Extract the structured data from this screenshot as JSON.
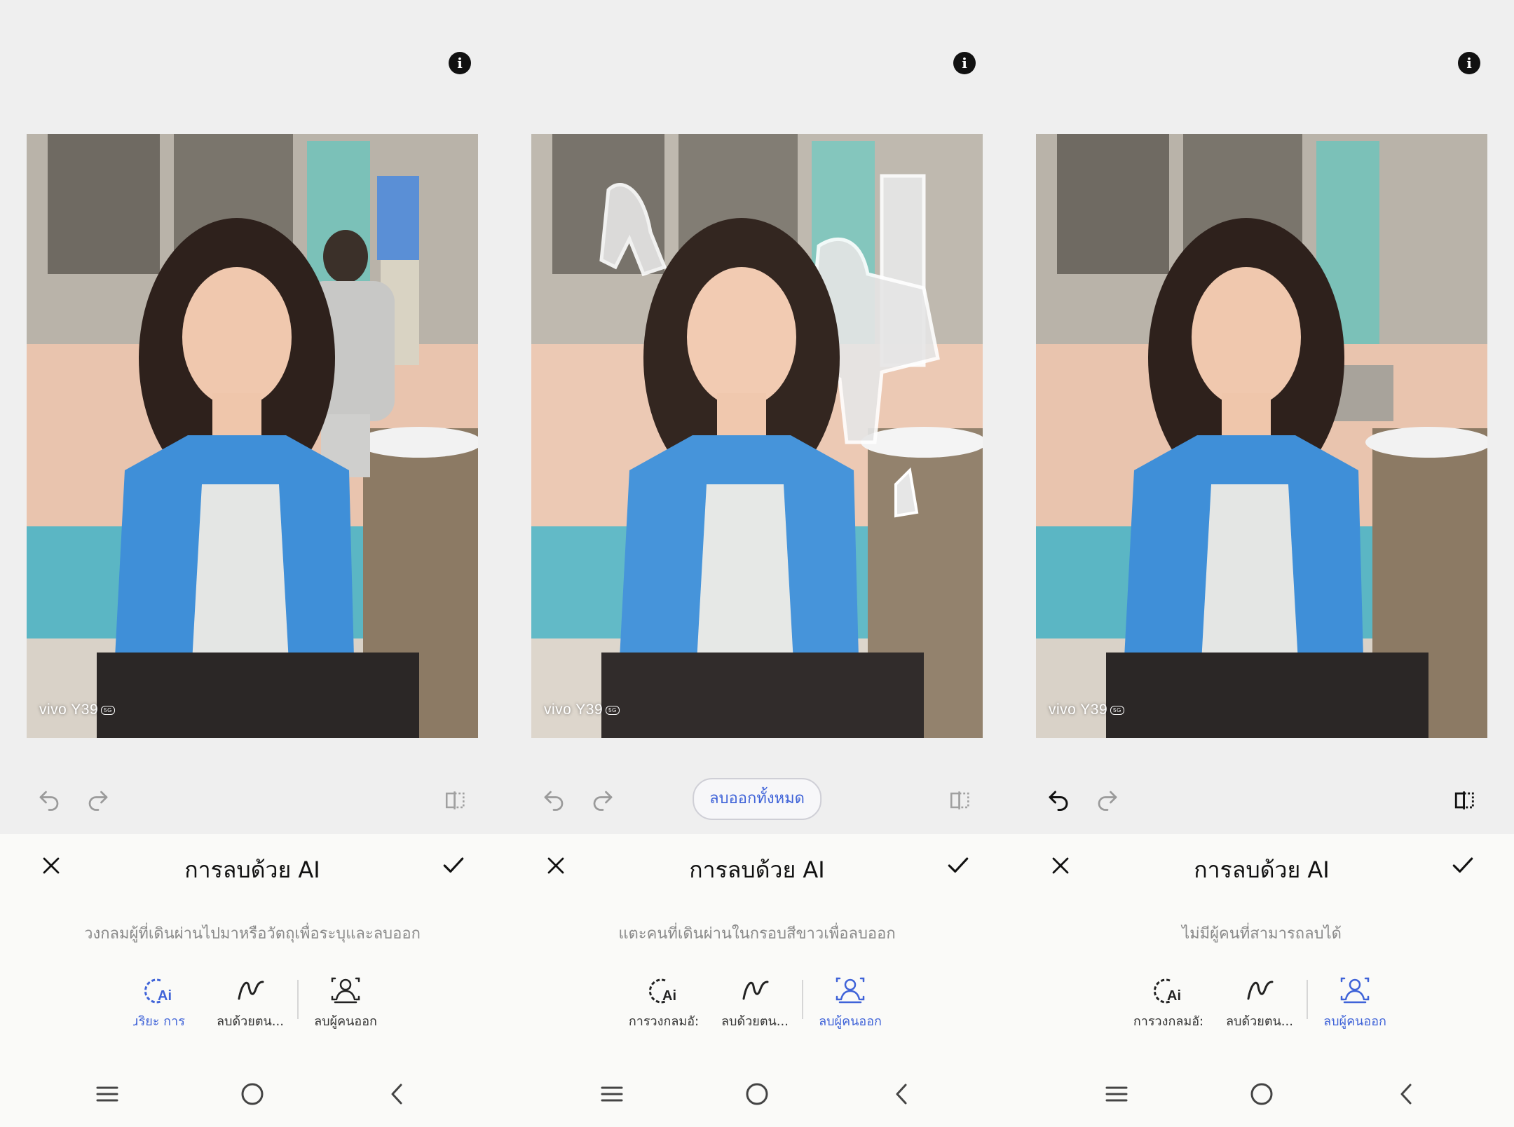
{
  "common": {
    "title": "การลบด้วย AI",
    "watermark_brand": "vivo Y39",
    "watermark_badge": "5G"
  },
  "screens": [
    {
      "hint": "วงกลมผู้ที่เดินผ่านไปมาหรือวัตถุเพื่อระบุและลบออก",
      "tools": [
        {
          "label": "ɹริยะ     การ",
          "icon": "ai-circle-icon",
          "active": true
        },
        {
          "label": "ลบด้วยตน...",
          "icon": "brush-stroke-icon",
          "active": false
        },
        {
          "label": "ลบผู้คนออก",
          "icon": "remove-people-icon",
          "active": false
        }
      ]
    },
    {
      "remove_all_label": "ลบออกทั้งหมด",
      "hint": "แตะคนที่เดินผ่านในกรอบสีขาวเพื่อลบออก",
      "tools": [
        {
          "label": "การวงกลมอั:",
          "icon": "ai-circle-icon",
          "active": false
        },
        {
          "label": "ลบด้วยตน...",
          "icon": "brush-stroke-icon",
          "active": false
        },
        {
          "label": "ลบผู้คนออก",
          "icon": "remove-people-icon",
          "active": true
        }
      ]
    },
    {
      "hint": "ไม่มีผู้คนที่สามารถลบได้",
      "tools": [
        {
          "label": "การวงกลมอั:",
          "icon": "ai-circle-icon",
          "active": false
        },
        {
          "label": "ลบด้วยตน...",
          "icon": "brush-stroke-icon",
          "active": false
        },
        {
          "label": "ลบผู้คนออก",
          "icon": "remove-people-icon",
          "active": true
        }
      ]
    }
  ],
  "colors": {
    "accent": "#3f63d8",
    "panel_bg": "#fafaf8",
    "screen_bg": "#efefef"
  }
}
